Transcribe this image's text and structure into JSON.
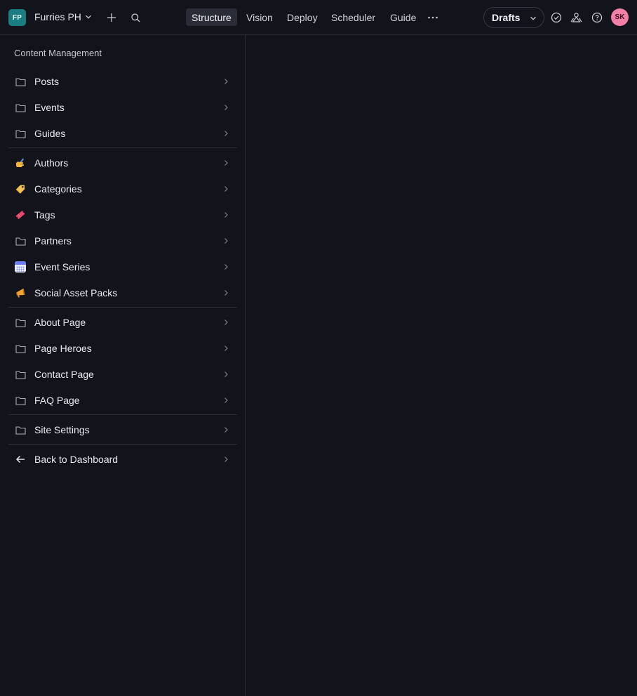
{
  "workspace": {
    "badge": "FP",
    "name": "Furries PH"
  },
  "nav": {
    "tabs": [
      {
        "label": "Structure",
        "active": true
      },
      {
        "label": "Vision",
        "active": false
      },
      {
        "label": "Deploy",
        "active": false
      },
      {
        "label": "Scheduler",
        "active": false
      },
      {
        "label": "Guide",
        "active": false
      }
    ]
  },
  "drafts": {
    "label": "Drafts"
  },
  "user": {
    "initials": "SK"
  },
  "colors": {
    "background": "#13141b",
    "workspace_badge": "#1a7d83",
    "avatar": "#f27fa5",
    "active_tab": "#2a2c37"
  },
  "sidebar": {
    "title": "Content Management",
    "items": [
      {
        "label": "Posts",
        "icon": "folder-icon"
      },
      {
        "label": "Events",
        "icon": "folder-icon"
      },
      {
        "label": "Guides",
        "icon": "folder-icon"
      },
      {
        "label": "Authors",
        "icon": "writing-hand-icon"
      },
      {
        "label": "Categories",
        "icon": "label-tag-icon"
      },
      {
        "label": "Tags",
        "icon": "ticket-icon"
      },
      {
        "label": "Partners",
        "icon": "folder-icon"
      },
      {
        "label": "Event Series",
        "icon": "calendar-icon"
      },
      {
        "label": "Social Asset Packs",
        "icon": "megaphone-icon"
      },
      {
        "label": "About Page",
        "icon": "folder-icon"
      },
      {
        "label": "Page Heroes",
        "icon": "folder-icon"
      },
      {
        "label": "Contact Page",
        "icon": "folder-icon"
      },
      {
        "label": "FAQ Page",
        "icon": "folder-icon"
      },
      {
        "label": "Site Settings",
        "icon": "folder-icon"
      },
      {
        "label": "Back to Dashboard",
        "icon": "arrow-left-icon"
      }
    ]
  }
}
